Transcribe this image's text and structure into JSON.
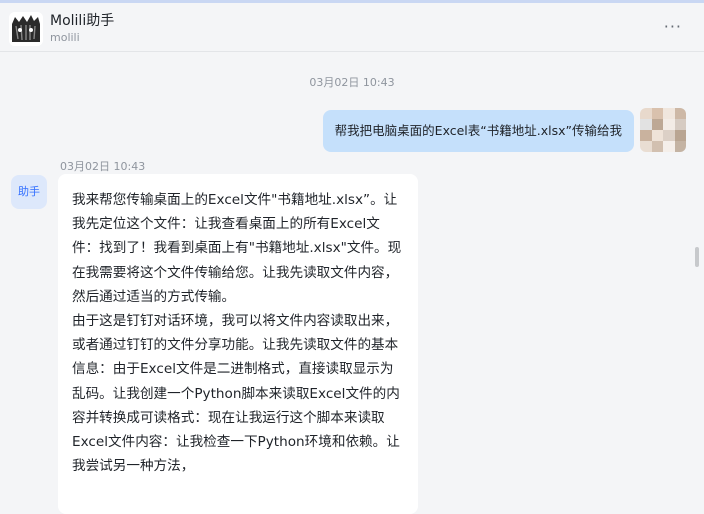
{
  "header": {
    "title": "Molili助手",
    "subtitle": "molili",
    "more_icon": "more-dots-icon"
  },
  "messages": {
    "center_time": "03月02日 10:43",
    "user_text": "帮我把电脑桌面的Excel表“书籍地址.xlsx”传输给我",
    "bot_label": "助手",
    "bot_time": "03月02日 10:43",
    "bot_paragraphs": [
      "我来帮您传输桌面上的Excel文件\"书籍地址.xlsx”。让我先定位这个文件：让我查看桌面上的所有Excel文件：找到了！我看到桌面上有\"书籍地址.xlsx\"文件。现在我需要将这个文件传输给您。让我先读取文件内容，然后通过适当的方式传输。",
      "由于这是钉钉对话环境，我可以将文件内容读取出来，或者通过钉钉的文件分享功能。让我先读取文件的基本信息：由于Excel文件是二进制格式，直接读取显示为乱码。让我创建一个Python脚本来读取Excel文件的内容并转换成可读格式：现在让我运行这个脚本来读取Excel文件内容：让我检查一下Python环境和依赖。让我尝试另一种方法，"
    ]
  },
  "colors": {
    "user_bubble": "#c5e0fb",
    "bot_bubble": "#ffffff",
    "background": "#f4f5f7",
    "accent": "#3370ff"
  }
}
